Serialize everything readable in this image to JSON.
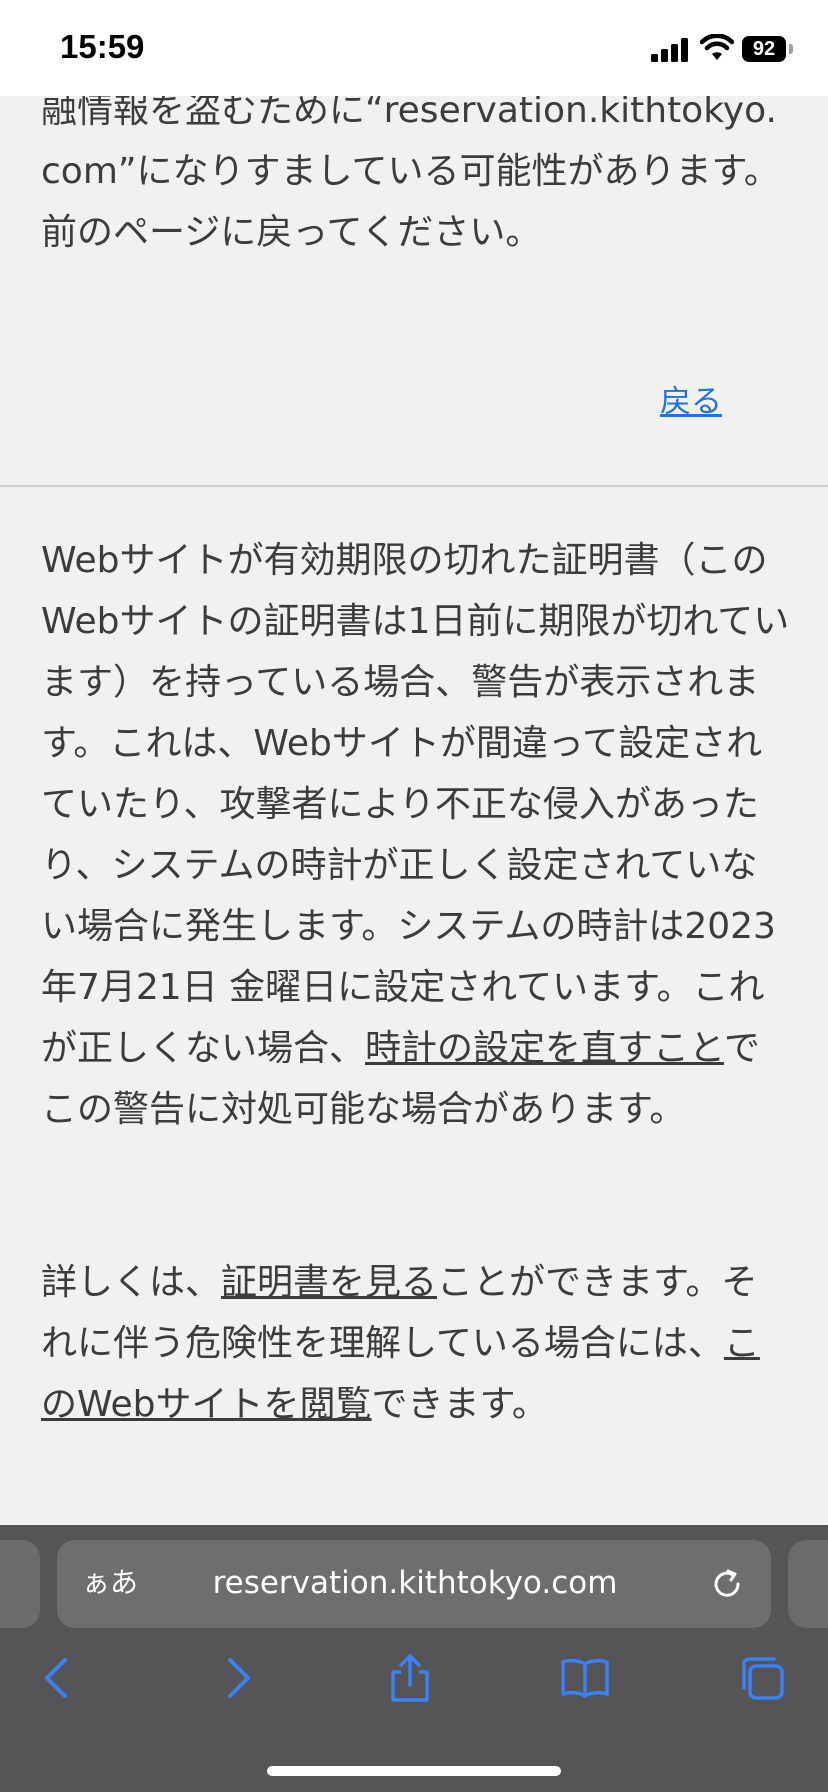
{
  "status_bar": {
    "time": "15:59",
    "battery": "92"
  },
  "warning": {
    "intro_text": "融情報を盗むために“reservation.kithtokyo.com”になりすましている可能性があります。前のページに戻ってください。",
    "back_link": "戻る",
    "main_text_1": "Webサイトが有効期限の切れた証明書（このWebサイトの証明書は1日前に期限が切れています）を持っている場合、警告が表示されます。これは、Webサイトが間違って設定されていたり、攻撃者により不正な侵入があったり、システムの時計が正しく設定されていない場合に発生します。システムの時計は2023年7月21日 金曜日に設定されています。これが正しくない場合、",
    "clock_link": "時計の設定を直すこと",
    "main_text_2": "でこの警告に対処可能な場合があります。",
    "detail_prefix": "詳しくは、",
    "cert_link": "証明書を見る",
    "detail_mid": "ことができます。それに伴う危険性を理解している場合には、",
    "visit_link": "このWebサイトを閲覧",
    "detail_suffix": "できます。"
  },
  "toolbar": {
    "aa_label": "ぁあ",
    "url": "reservation.kithtokyo.com",
    "icons": [
      "back-icon",
      "forward-icon",
      "share-icon",
      "bookmarks-icon",
      "tabs-icon",
      "reload-icon"
    ],
    "accent_color": "#3b82f6"
  }
}
